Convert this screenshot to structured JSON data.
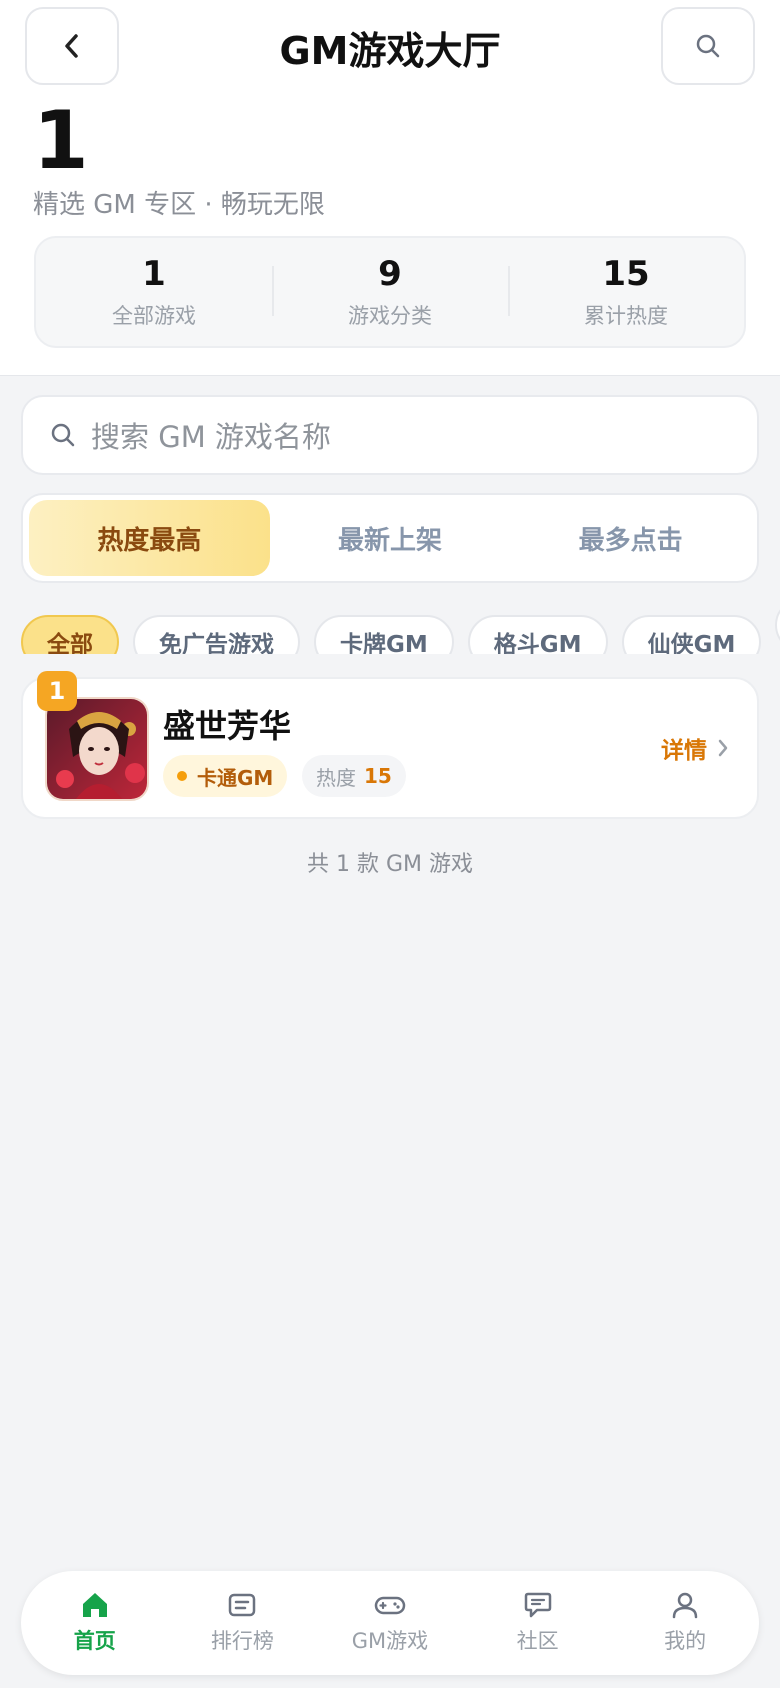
{
  "header": {
    "title": "GM游戏大厅",
    "back_icon": "chevron-left-icon",
    "search_icon": "search-icon"
  },
  "hero": {
    "big_number": "1",
    "subtitle": "精选 GM 专区 · 畅玩无限"
  },
  "stats": [
    {
      "value": "1",
      "label": "全部游戏"
    },
    {
      "value": "9",
      "label": "游戏分类"
    },
    {
      "value": "15",
      "label": "累计热度"
    }
  ],
  "search": {
    "placeholder": "搜索 GM 游戏名称"
  },
  "sort_tabs": [
    {
      "label": "热度最高",
      "active": true
    },
    {
      "label": "最新上架",
      "active": false
    },
    {
      "label": "最多点击",
      "active": false
    }
  ],
  "categories": [
    {
      "label": "全部",
      "active": true
    },
    {
      "label": "免广告游戏",
      "active": false
    },
    {
      "label": "卡牌GM",
      "active": false
    },
    {
      "label": "格斗GM",
      "active": false
    },
    {
      "label": "仙侠GM",
      "active": false
    }
  ],
  "games": [
    {
      "rank": "1",
      "name": "盛世芳华",
      "genre": "卡通GM",
      "heat_label": "热度",
      "heat_value": "15",
      "detail_label": "详情"
    }
  ],
  "footer_text": "共 1 款 GM 游戏",
  "bottom_nav": [
    {
      "label": "首页",
      "icon": "home-icon",
      "active": true
    },
    {
      "label": "排行榜",
      "icon": "list-icon",
      "active": false
    },
    {
      "label": "GM游戏",
      "icon": "gamepad-icon",
      "active": false
    },
    {
      "label": "社区",
      "icon": "chat-icon",
      "active": false
    },
    {
      "label": "我的",
      "icon": "user-icon",
      "active": false
    }
  ],
  "colors": {
    "accent_gold": "#fbe18a",
    "accent_orange": "#d97706",
    "active_green": "#16a34a"
  }
}
